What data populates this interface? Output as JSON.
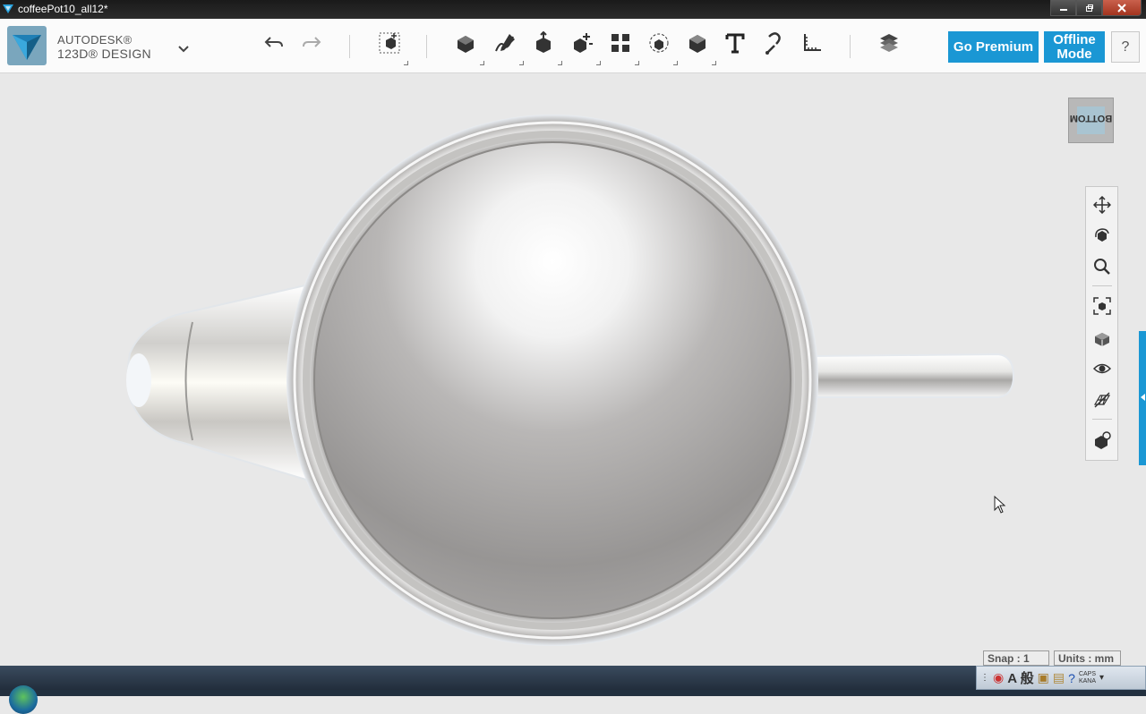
{
  "window": {
    "title": "coffeePot10_all12*",
    "controls": [
      "minimize",
      "restore",
      "close"
    ]
  },
  "brand": {
    "line1": "AUTODESK®",
    "line2": "123D® DESIGN"
  },
  "toolbar": {
    "tools": [
      {
        "name": "undo-icon"
      },
      {
        "name": "redo-icon"
      },
      {
        "name": "primitives-icon"
      },
      {
        "name": "sketch-icon"
      },
      {
        "name": "construct-icon"
      },
      {
        "name": "modify-icon"
      },
      {
        "name": "pattern-icon"
      },
      {
        "name": "grouping-icon"
      },
      {
        "name": "combine-icon"
      },
      {
        "name": "measure-icon"
      },
      {
        "name": "text-icon"
      },
      {
        "name": "snap-icon"
      },
      {
        "name": "material-icon"
      },
      {
        "name": "layers-icon"
      }
    ],
    "go_premium": "Go Premium",
    "offline_mode": "Offline\nMode",
    "help": "?"
  },
  "viewcube": {
    "face_label": "BOTTOM"
  },
  "nav_tools": [
    "pan-icon",
    "orbit-icon",
    "zoom-icon",
    "fit-icon",
    "view-mode-icon",
    "visibility-icon",
    "grid-toggle-icon",
    "material-visibility-icon"
  ],
  "status": {
    "snap": "Snap : 1",
    "units": "Units : mm"
  },
  "tray": {
    "ime_mode": "A 般",
    "caps_label": "CAPS",
    "kana_label": "KANA"
  }
}
